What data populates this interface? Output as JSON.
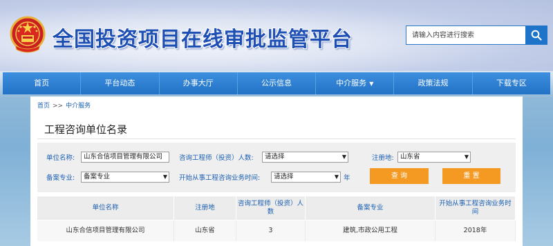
{
  "header": {
    "title": "全国投资项目在线审批监管平台",
    "search_placeholder": "请输入内容进行搜索"
  },
  "nav": {
    "items": [
      {
        "label": "首页"
      },
      {
        "label": "平台动态"
      },
      {
        "label": "办事大厅"
      },
      {
        "label": "公示信息"
      },
      {
        "label": "中介服务",
        "caret": "▼"
      },
      {
        "label": "政策法规"
      },
      {
        "label": "下载专区"
      }
    ]
  },
  "breadcrumb": {
    "home": "首页",
    "sep": ">>",
    "current": "中介服务"
  },
  "page": {
    "title": "工程咨询单位名录"
  },
  "filters": {
    "unit_name_label": "单位名称:",
    "unit_name_value": "山东合信项目管理有限公司",
    "engineer_count_label": "咨询工程师（投资）人数:",
    "engineer_count_value": "请选择",
    "registration_label": "注册地:",
    "registration_value": "山东省",
    "major_label": "备案专业:",
    "major_value": "备案专业",
    "start_time_label": "开始从事工程咨询业务时间:",
    "start_time_value": "请选择",
    "year_unit": "年",
    "query_button": "查 询",
    "reset_button": "重 置"
  },
  "table": {
    "headers": [
      "单位名称",
      "注册地",
      "咨询工程师（投资）人数",
      "备案专业",
      "开始从事工程咨询业务时间"
    ],
    "rows": [
      [
        "山东合信项目管理有限公司",
        "山东省",
        "3",
        "建筑,市政公用工程",
        "2018年"
      ]
    ]
  },
  "colors": {
    "nav_blue": "#2272c6",
    "button_orange": "#f49a22",
    "title_blue": "#1d4fb5"
  }
}
